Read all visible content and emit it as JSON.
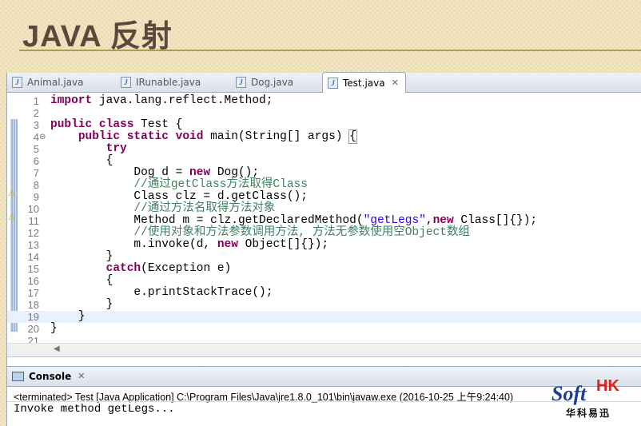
{
  "slide": {
    "title": "JAVA 反射"
  },
  "editor_tabs": [
    {
      "label": "Animal.java",
      "active": false
    },
    {
      "label": "IRunable.java",
      "active": false
    },
    {
      "label": "Dog.java",
      "active": false
    },
    {
      "label": "Test.java",
      "active": true
    }
  ],
  "code_lines": [
    {
      "n": "1",
      "code": "import java.lang.reflect.Method;"
    },
    {
      "n": "2",
      "code": ""
    },
    {
      "n": "3",
      "code": "public class Test {"
    },
    {
      "n": "4",
      "code": "    public static void main(String[] args) {"
    },
    {
      "n": "5",
      "code": "        try"
    },
    {
      "n": "6",
      "code": "        {"
    },
    {
      "n": "7",
      "code": "            Dog d = new Dog();"
    },
    {
      "n": "8",
      "code": "            //通过getClass方法取得Class"
    },
    {
      "n": "9",
      "code": "            Class clz = d.getClass();"
    },
    {
      "n": "10",
      "code": "            //通过方法名取得方法对象"
    },
    {
      "n": "11",
      "code": "            Method m = clz.getDeclaredMethod(\"getLegs\",new Class[]{});"
    },
    {
      "n": "12",
      "code": "            //使用对象和方法参数调用方法, 方法无参数使用空Object数组"
    },
    {
      "n": "13",
      "code": "            m.invoke(d, new Object[]{});"
    },
    {
      "n": "14",
      "code": "        }"
    },
    {
      "n": "15",
      "code": "        catch(Exception e)"
    },
    {
      "n": "16",
      "code": "        {"
    },
    {
      "n": "17",
      "code": "            e.printStackTrace();"
    },
    {
      "n": "18",
      "code": "        }"
    },
    {
      "n": "19",
      "code": "    }"
    },
    {
      "n": "20",
      "code": "}"
    },
    {
      "n": "21",
      "code": ""
    }
  ],
  "console": {
    "tab_label": "Console",
    "status": "<terminated> Test [Java Application] C:\\Program Files\\Java\\jre1.8.0_101\\bin\\javaw.exe (2016-10-25 上午9:24:40)",
    "output": "Invoke method getLegs..."
  },
  "logo": {
    "soft": "Soft",
    "hk": "HK",
    "cn": "华科易迅"
  },
  "colors": {
    "keyword": "#7f0055",
    "comment": "#3f7f5f",
    "string": "#2a00ff",
    "slide_bg": "#f3e7c3",
    "title": "#5a4a3c"
  }
}
